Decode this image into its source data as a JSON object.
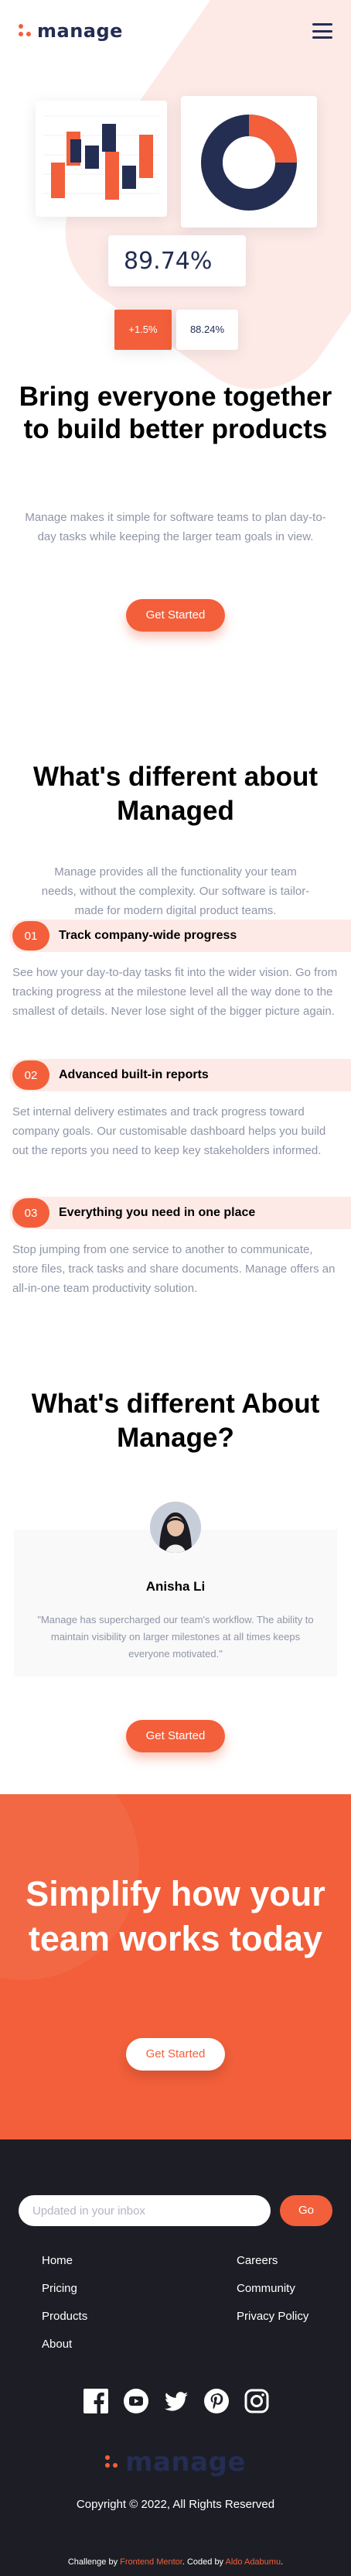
{
  "brand": {
    "name": "manage",
    "accent": "#f25f3a",
    "navy": "#242d52",
    "light_accent": "#fdeae6",
    "footer_bg": "#1d1e25"
  },
  "header": {
    "menu_icon": "hamburger-icon"
  },
  "hero": {
    "stat_value": "89.74%",
    "change_up": "+1.5%",
    "change_value": "88.24%",
    "title": "Bring everyone together to build better products",
    "text": "Manage makes it simple for software teams to plan day-to-day tasks while keeping the larger team goals in view.",
    "button": "Get Started"
  },
  "features": {
    "title": "What's different about Managed",
    "text": "Manage provides all the functionality your team needs, without the complexity. Our software is tailor-made for modern digital product teams.",
    "items": [
      {
        "num": "01",
        "name": "Track company-wide progress",
        "desc": "See how your day-to-day tasks fit into the wider vision. Go from tracking progress at the milestone level all the way done to the smallest of details. Never lose sight of the bigger picture again."
      },
      {
        "num": "02",
        "name": "Advanced built-in reports",
        "desc": "Set internal delivery estimates and track progress toward company goals. Our customisable dashboard helps you build out the reports you need to keep key stakeholders informed."
      },
      {
        "num": "03",
        "name": "Everything you need in one place",
        "desc": "Stop jumping from one service to another to communicate, store files, track tasks and share documents. Manage offers an all-in-one team productivity solution."
      }
    ]
  },
  "testimonials": {
    "title": "What's different About Manage?",
    "name": "Anisha Li",
    "quote": "\"Manage has supercharged our team's workflow. The ability to maintain visibility on larger milestones at all times keeps everyone motivated.\"",
    "button": "Get Started"
  },
  "cta": {
    "title": "Simplify how your team works today",
    "button": "Get Started"
  },
  "footer": {
    "subscribe_placeholder": "Updated in your inbox",
    "go": "Go",
    "links_col1": [
      "Home",
      "Pricing",
      "Products",
      "About"
    ],
    "links_col2": [
      "Careers",
      "Community",
      "Privacy Policy"
    ],
    "socials": [
      "facebook-icon",
      "youtube-icon",
      "twitter-icon",
      "pinterest-icon",
      "instagram-icon"
    ],
    "copyright": "Copyright © 2022, All Rights Reserved",
    "attribution_prefix": "Challenge by",
    "attribution_fm": "Frontend Mentor",
    "attribution_mid": ". Coded by",
    "attribution_author": "Aldo Adabumu",
    "attribution_end": "."
  }
}
